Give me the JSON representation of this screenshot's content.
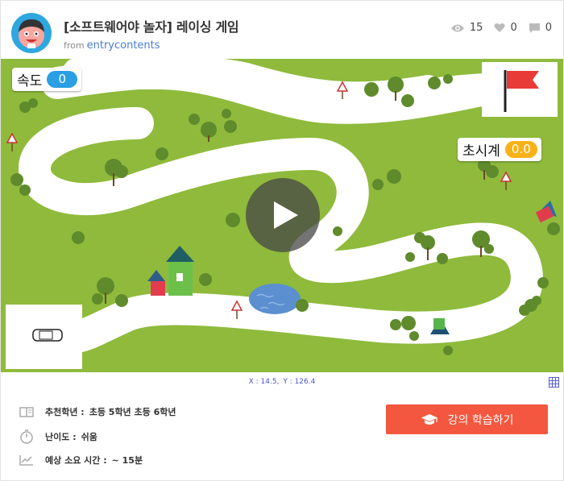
{
  "header": {
    "title": "[소프트웨어야 놀자] 레이싱 게임",
    "from_label": "from",
    "author": "entrycontents",
    "views": "15",
    "likes": "0",
    "comments": "0"
  },
  "stage": {
    "speed_label": "속도",
    "speed_value": "0",
    "timer_label": "초시계",
    "timer_value": "0.0"
  },
  "coords": {
    "x_label": "X : 14.5,",
    "y_label": "Y : 126.4"
  },
  "info": {
    "grade_label": "추천학년 :",
    "grade_value": "초등 5학년 초등 6학년",
    "difficulty_label": "난이도 :",
    "difficulty_value": "쉬움",
    "time_label": "예상 소요 시간 :",
    "time_value": "~ 15분"
  },
  "learn_button": "강의 학습하기",
  "colors": {
    "accent": "#f4573f",
    "speed_pill": "#2b9fe3",
    "timer_pill": "#f7b218",
    "grass": "#8fba3c",
    "link": "#4a7dd6"
  },
  "icons": [
    "eye-icon",
    "heart-icon",
    "comment-icon",
    "play-icon",
    "grid-icon",
    "book-icon",
    "clock-icon",
    "chart-icon",
    "graduation-cap-icon"
  ]
}
